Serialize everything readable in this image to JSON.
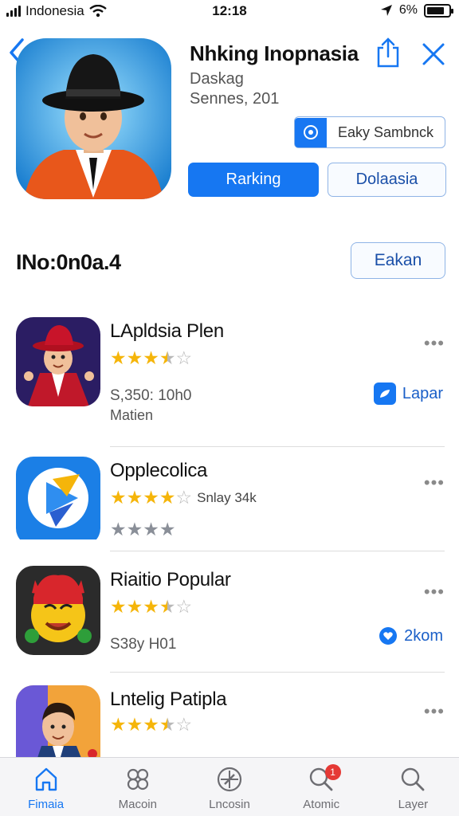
{
  "status_bar": {
    "carrier": "Indonesia",
    "time": "12:18",
    "battery": "6%"
  },
  "header": {
    "title": "Nhking Inopnasia",
    "subtitle_1": "Daskag",
    "subtitle_2": "Sennes, 201",
    "chip_label": "Eaky Sambnck",
    "primary_button": "Rarking",
    "secondary_button": "Dolaasia"
  },
  "section": {
    "title": "INo:0n0a.4",
    "button": "Eakan"
  },
  "apps": [
    {
      "name": "LApldsia Plen",
      "rating": 3.5,
      "meta_1": "S,350: 10h0",
      "meta_2": "Matien",
      "action": "Lapar",
      "action_icon": "bookmark-icon"
    },
    {
      "name": "Opplecolica",
      "rating": 4,
      "rating_extra": "Snlay 34k",
      "secondary_rating": 4
    },
    {
      "name": "Riaitio Popular",
      "rating": 3.5,
      "meta_1": "S38y H01",
      "action": "2kom",
      "action_icon": "heart-icon"
    },
    {
      "name": "Lntelig Patipla",
      "rating": 3.5
    }
  ],
  "tabs": [
    {
      "label": "Fimaia",
      "icon": "home-icon",
      "active": true
    },
    {
      "label": "Macoin",
      "icon": "apps-icon"
    },
    {
      "label": "Lncosin",
      "icon": "compass-icon"
    },
    {
      "label": "Atomic",
      "icon": "search-icon",
      "badge": "1"
    },
    {
      "label": "Layer",
      "icon": "search-icon"
    }
  ],
  "colors": {
    "accent": "#1677f2",
    "star": "#f5b50a",
    "badge": "#e53935"
  }
}
